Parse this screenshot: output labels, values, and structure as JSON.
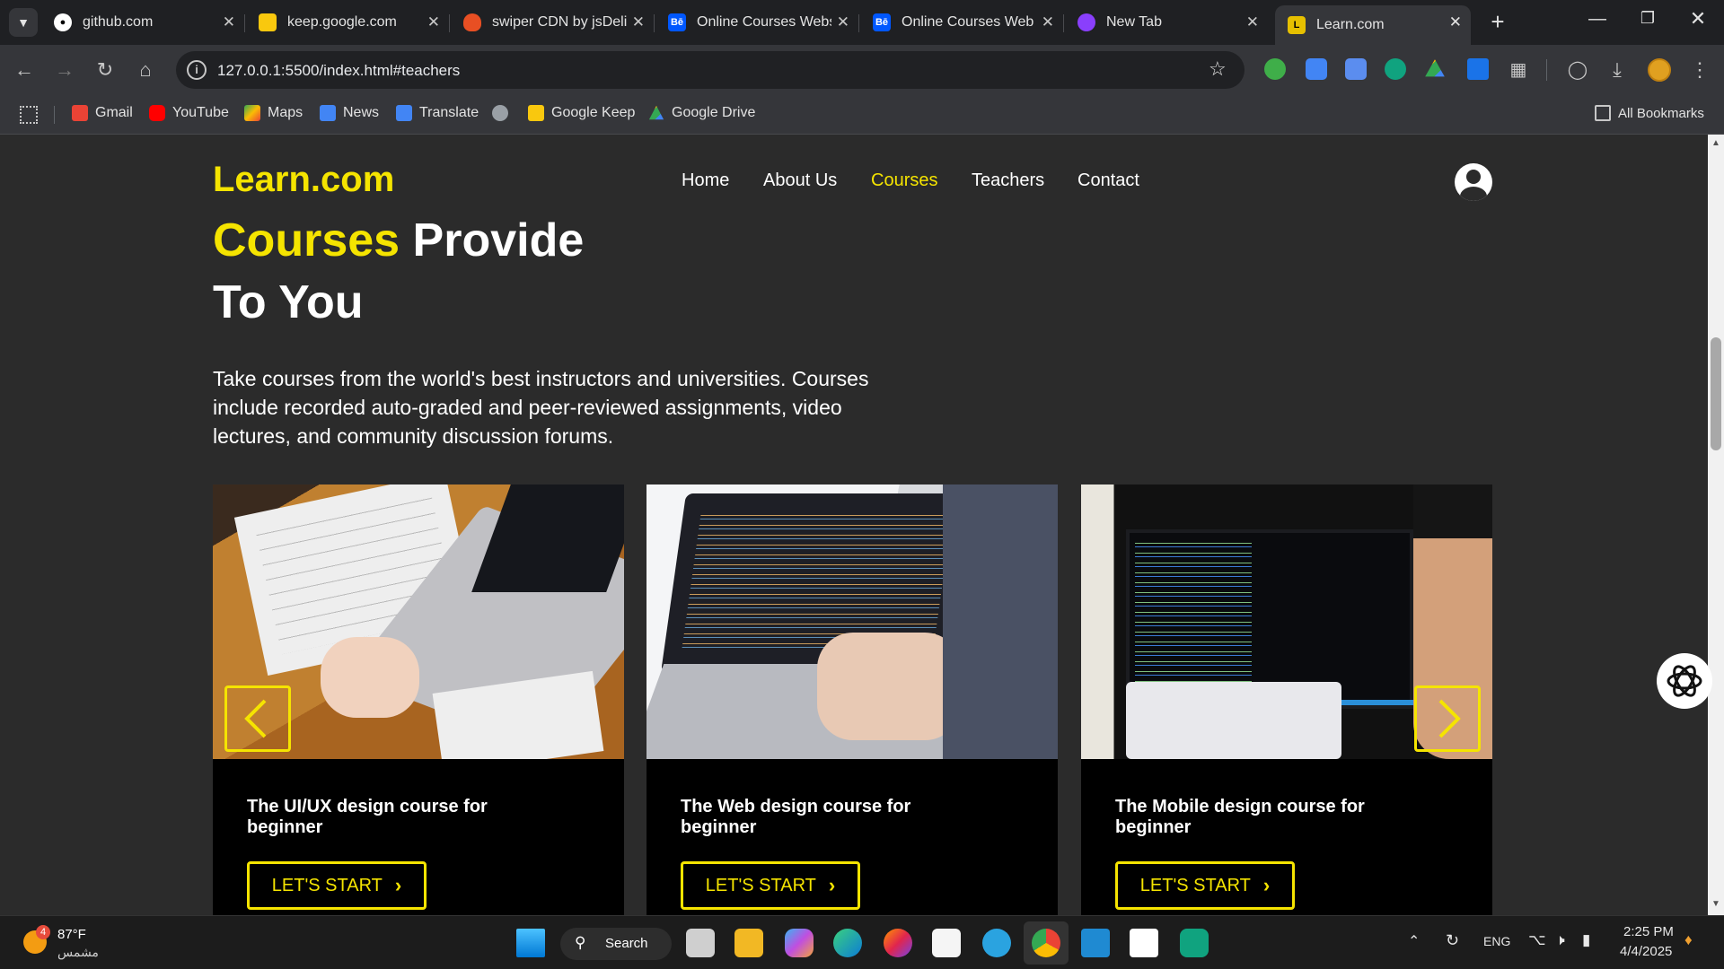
{
  "browser": {
    "tabs": [
      {
        "title": "github.com",
        "favicon_color": "#000000"
      },
      {
        "title": "keep.google.com",
        "favicon_color": "#f9c80e"
      },
      {
        "title": "swiper CDN by jsDeliv",
        "favicon_color": "#e84f23"
      },
      {
        "title": "Online Courses Webs",
        "favicon_color": "#0057ff",
        "favicon_text": "Bē"
      },
      {
        "title": "Online Courses Web",
        "favicon_color": "#0057ff",
        "favicon_text": "Bē"
      },
      {
        "title": "New Tab",
        "favicon_color": "#8a3ffc"
      },
      {
        "title": "Learn.com",
        "favicon_color": "#e6c000",
        "favicon_text": "L"
      }
    ],
    "new_tab_glyph": "+",
    "url": "127.0.0.1:5500/index.html#teachers",
    "bookmarks": [
      {
        "label": "Gmail",
        "color": "#ea4335"
      },
      {
        "label": "YouTube",
        "color": "#ff0000"
      },
      {
        "label": "Maps",
        "color": "#34a853"
      },
      {
        "label": "News",
        "color": "#4285f4"
      },
      {
        "label": "Translate",
        "color": "#4285f4"
      },
      {
        "label": "Google Keep",
        "color": "#f9c80e"
      },
      {
        "label": "Google Drive",
        "color": "#0f9d58"
      }
    ],
    "all_bookmarks": "All Bookmarks"
  },
  "site": {
    "logo": "Learn.com",
    "nav": [
      "Home",
      "About Us",
      "Courses",
      "Teachers",
      "Contact"
    ],
    "active_nav": "Courses",
    "accent": "#f5e400",
    "hero": {
      "title_highlight": "Courses",
      "title_rest": " Provide",
      "title_line2": "To You",
      "description": "Take courses from the world's best instructors and universities. Courses include recorded auto-graded and peer-reviewed assignments, video lectures, and community discussion forums."
    },
    "courses": [
      {
        "title": "The UI/UX design course for beginner",
        "button": "LET'S START"
      },
      {
        "title": "The Web design course for beginner",
        "button": "LET'S START"
      },
      {
        "title": "The Mobile design course for beginner",
        "button": "LET'S START"
      }
    ]
  },
  "taskbar": {
    "weather_temp": "87°F",
    "weather_desc": "مشمس",
    "weather_badge": "4",
    "search_label": "Search",
    "language": "ENG",
    "time": "2:25 PM",
    "date": "4/4/2025"
  }
}
